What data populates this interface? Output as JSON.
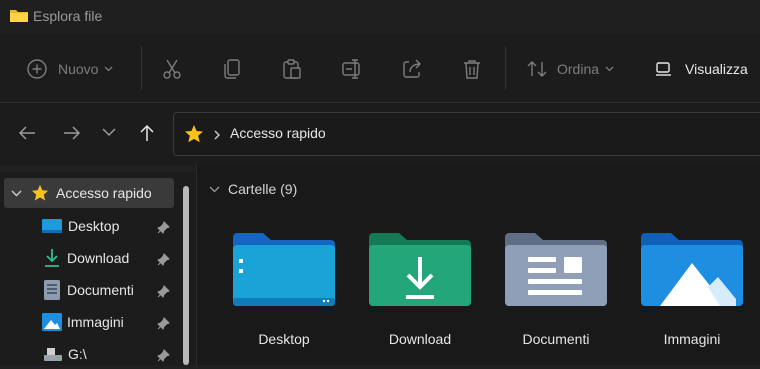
{
  "window": {
    "title": "Esplora file",
    "icon": "folder-icon"
  },
  "command_bar": {
    "new_label": "Nuovo",
    "sort_label": "Ordina",
    "view_label": "Visualizza",
    "icons": [
      "plus-circle-icon",
      "cut-icon",
      "copy-icon",
      "paste-icon",
      "rename-icon",
      "share-icon",
      "delete-icon",
      "sort-icon",
      "view-icon"
    ]
  },
  "navigation": {
    "address_text": "Accesso rapido",
    "icons": [
      "back-arrow-icon",
      "forward-arrow-icon",
      "chevron-down-icon",
      "up-arrow-icon",
      "star-icon"
    ]
  },
  "sidebar": {
    "items": [
      {
        "label": "Accesso rapido",
        "icon": "star-icon",
        "expanded": true,
        "selected": true
      },
      {
        "label": "Desktop",
        "icon": "desktop-icon",
        "pinned": true
      },
      {
        "label": "Download",
        "icon": "download-icon",
        "pinned": true
      },
      {
        "label": "Documenti",
        "icon": "document-icon",
        "pinned": true
      },
      {
        "label": "Immagini",
        "icon": "pictures-icon",
        "pinned": true
      },
      {
        "label": "G:\\",
        "icon": "drive-icon",
        "pinned": true
      }
    ]
  },
  "content": {
    "group_header": "Cartelle (9)",
    "folders": [
      {
        "label": "Desktop",
        "color": "#1aa3d6"
      },
      {
        "label": "Download",
        "color": "#22a67a"
      },
      {
        "label": "Documenti",
        "color": "#8f9fb8"
      },
      {
        "label": "Immagini",
        "color": "#1e8fe0"
      }
    ]
  }
}
